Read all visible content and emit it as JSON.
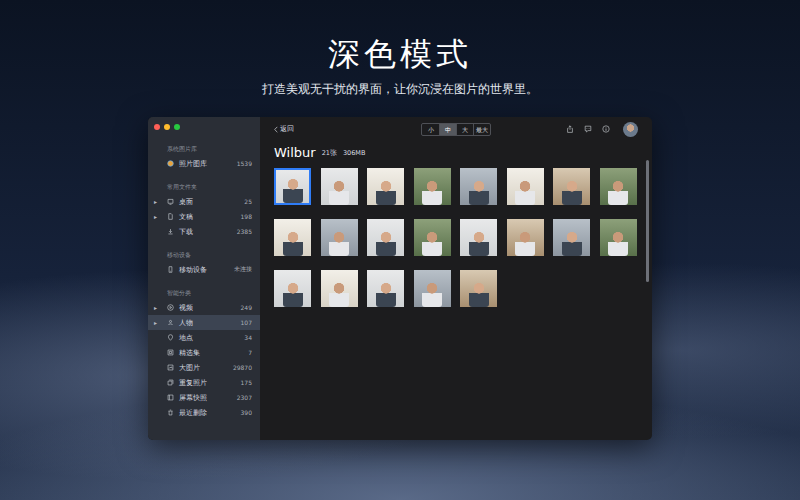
{
  "promo": {
    "headline": "深色模式",
    "subtitle": "打造美观无干扰的界面，让你沉浸在图片的世界里。"
  },
  "window": {
    "traffic_lights": [
      {
        "color": "#fe5f57"
      },
      {
        "color": "#febc2e"
      },
      {
        "color": "#28c840"
      }
    ]
  },
  "sidebar": {
    "sections": [
      {
        "title": "系统图片库",
        "items": [
          {
            "label": "照片图库",
            "count": "1539",
            "arrow": "",
            "selected": false
          }
        ]
      },
      {
        "title": "常用文件夹",
        "items": [
          {
            "label": "桌面",
            "count": "25",
            "arrow": "▸",
            "selected": false
          },
          {
            "label": "文稿",
            "count": "198",
            "arrow": "▸",
            "selected": false
          },
          {
            "label": "下载",
            "count": "2385",
            "arrow": "",
            "selected": false
          }
        ]
      },
      {
        "title": "移动设备",
        "items": [
          {
            "label": "移动设备",
            "count": "未连接",
            "arrow": "",
            "selected": false
          }
        ]
      },
      {
        "title": "智能分类",
        "items": [
          {
            "label": "视频",
            "count": "249",
            "arrow": "▸",
            "selected": false
          },
          {
            "label": "人物",
            "count": "107",
            "arrow": "▸",
            "selected": true
          },
          {
            "label": "地点",
            "count": "34",
            "arrow": "",
            "selected": false
          },
          {
            "label": "精选集",
            "count": "7",
            "arrow": "",
            "selected": false
          },
          {
            "label": "大图片",
            "count": "29870",
            "arrow": "",
            "selected": false
          },
          {
            "label": "重复照片",
            "count": "175",
            "arrow": "",
            "selected": false
          },
          {
            "label": "屏幕快照",
            "count": "2307",
            "arrow": "",
            "selected": false
          },
          {
            "label": "最近删除",
            "count": "390",
            "arrow": "",
            "selected": false
          }
        ]
      }
    ]
  },
  "toolbar": {
    "back": "返回",
    "sizes": [
      {
        "label": "小",
        "selected": false
      },
      {
        "label": "中",
        "selected": true
      },
      {
        "label": "大",
        "selected": false
      },
      {
        "label": "最大",
        "selected": false
      }
    ]
  },
  "album": {
    "title": "Wilbur",
    "count": "21张",
    "size": "306MB"
  },
  "photos": [
    {
      "selected": true
    },
    {
      "selected": false
    },
    {
      "selected": false
    },
    {
      "selected": false
    },
    {
      "selected": false
    },
    {
      "selected": false
    },
    {
      "selected": false
    },
    {
      "selected": false
    },
    {
      "selected": false
    },
    {
      "selected": false
    },
    {
      "selected": false
    },
    {
      "selected": false
    },
    {
      "selected": false
    },
    {
      "selected": false
    },
    {
      "selected": false
    },
    {
      "selected": false
    },
    {
      "selected": false
    },
    {
      "selected": false
    },
    {
      "selected": false
    },
    {
      "selected": false
    },
    {
      "selected": false
    }
  ],
  "scrollbar": {
    "level": 0.45
  }
}
